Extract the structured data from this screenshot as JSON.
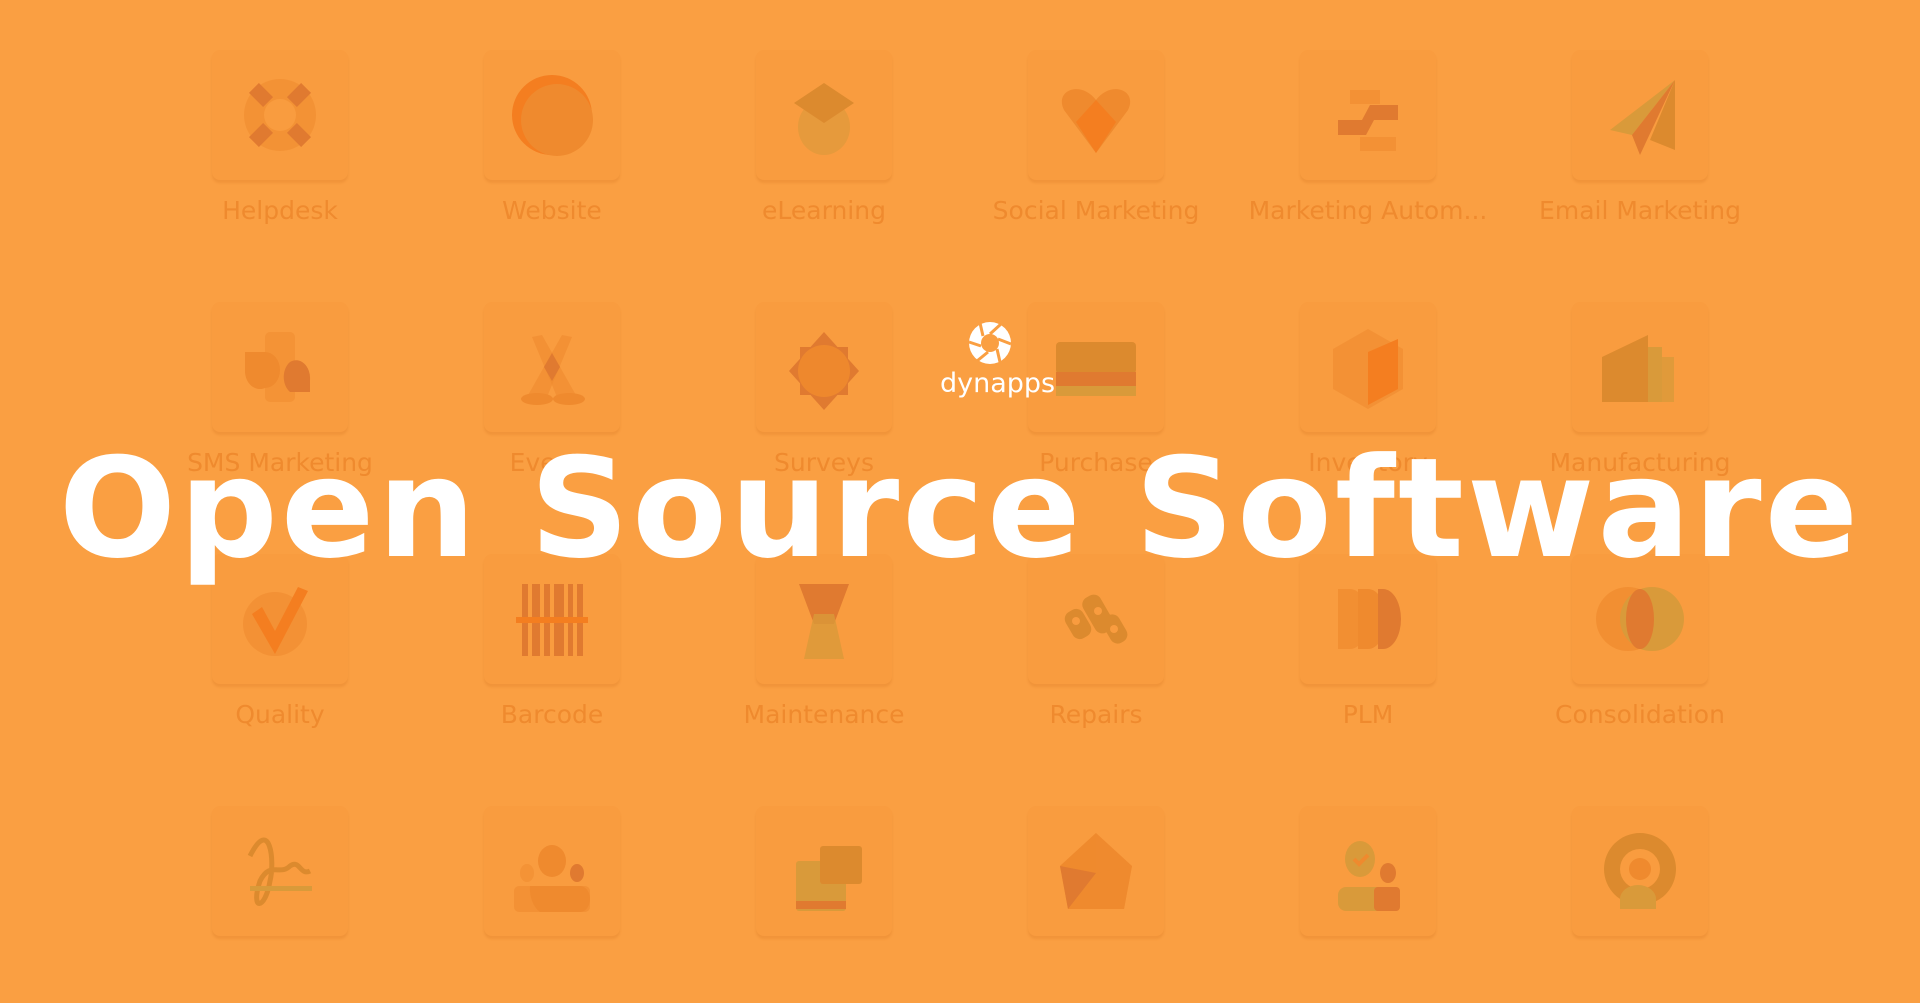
{
  "background_color": "#FA9F42",
  "brand": {
    "name": "dynapps",
    "logo_icon": "aperture-icon"
  },
  "headline": "Open Source Software",
  "apps": [
    {
      "label": "Helpdesk",
      "icon": "lifebuoy-icon"
    },
    {
      "label": "Website",
      "icon": "globe-circle-icon"
    },
    {
      "label": "eLearning",
      "icon": "graduation-cap-icon"
    },
    {
      "label": "Social Marketing",
      "icon": "heart-icon"
    },
    {
      "label": "Marketing Autom...",
      "icon": "automation-arrows-icon"
    },
    {
      "label": "Email Marketing",
      "icon": "paper-plane-icon"
    },
    {
      "label": "SMS Marketing",
      "icon": "sms-bubbles-icon"
    },
    {
      "label": "Events",
      "icon": "spotlights-icon"
    },
    {
      "label": "Surveys",
      "icon": "star-badge-icon"
    },
    {
      "label": "Purchase",
      "icon": "credit-card-icon"
    },
    {
      "label": "Inventory",
      "icon": "box-hexagon-icon"
    },
    {
      "label": "Manufacturing",
      "icon": "factory-icon"
    },
    {
      "label": "Quality",
      "icon": "checkmark-icon"
    },
    {
      "label": "Barcode",
      "icon": "barcode-icon"
    },
    {
      "label": "Maintenance",
      "icon": "wrench-cross-icon"
    },
    {
      "label": "Repairs",
      "icon": "chain-links-icon"
    },
    {
      "label": "PLM",
      "icon": "layers-icon"
    },
    {
      "label": "Consolidation",
      "icon": "overlapping-circles-icon"
    },
    {
      "label": "",
      "icon": "signature-icon"
    },
    {
      "label": "",
      "icon": "group-people-icon"
    },
    {
      "label": "",
      "icon": "cards-icon"
    },
    {
      "label": "",
      "icon": "gem-pentagon-icon"
    },
    {
      "label": "",
      "icon": "attendance-person-icon"
    },
    {
      "label": "",
      "icon": "location-q-icon"
    }
  ]
}
